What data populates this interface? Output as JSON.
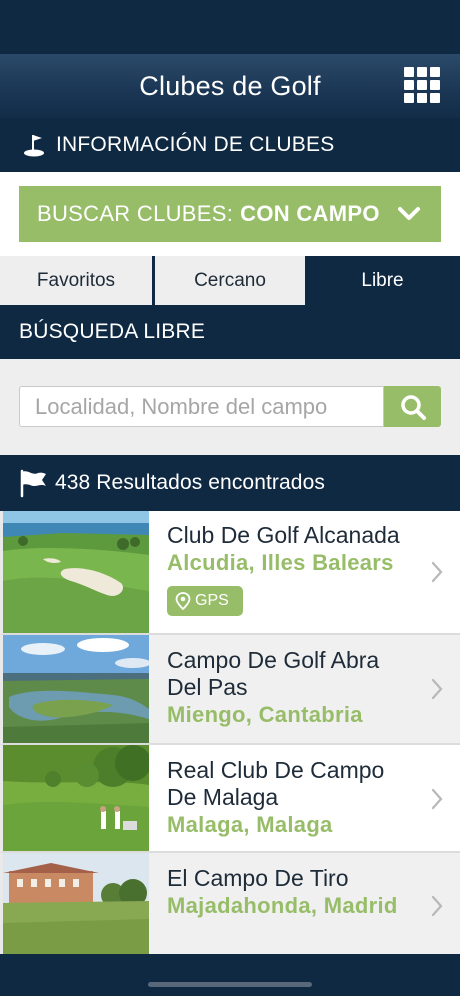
{
  "nav": {
    "title": "Clubes de Golf",
    "menu_icon": "grid-menu-icon"
  },
  "section": {
    "icon": "golf-flag-icon",
    "label": "INFORMACIÓN DE CLUBES"
  },
  "search_clubs": {
    "prefix": "BUSCAR CLUBES:",
    "value": "CON CAMPO",
    "icon": "chevron-down-icon"
  },
  "tabs": [
    {
      "label": "Favoritos",
      "active": false
    },
    {
      "label": "Cercano",
      "active": false
    },
    {
      "label": "Libre",
      "active": true
    }
  ],
  "free_search": {
    "title": "BÚSQUEDA LIBRE",
    "placeholder": "Localidad, Nombre del campo",
    "value": "",
    "button_icon": "search-icon"
  },
  "results": {
    "icon": "flag-icon",
    "label": "438 Resultados encontrados"
  },
  "clubs": [
    {
      "name": "Club De Golf Alcanada",
      "location": "Alcudia, Illes Balears",
      "gps": "GPS"
    },
    {
      "name": "Campo De Golf Abra Del Pas",
      "location": "Miengo, Cantabria"
    },
    {
      "name": "Real Club De Campo De Malaga",
      "location": "Malaga, Malaga"
    },
    {
      "name": "El Campo De Tiro",
      "location": "Majadahonda, Madrid"
    }
  ],
  "colors": {
    "navy": "#0f2943",
    "accent_green": "#97bd69",
    "tab_bg": "#eeeeee"
  }
}
